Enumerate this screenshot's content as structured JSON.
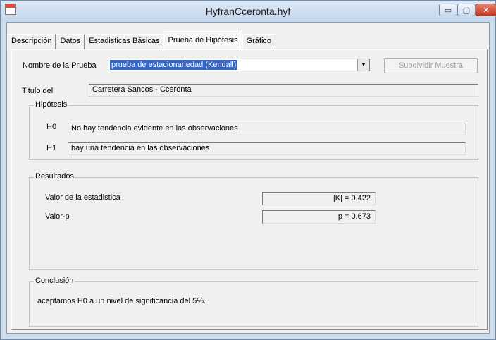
{
  "window": {
    "title": "HyfranCceronta.hyf",
    "controls": {
      "minimize": "▭",
      "maximize": "▢",
      "close": "✕"
    }
  },
  "tabs": [
    {
      "label": "Descripción"
    },
    {
      "label": "Datos"
    },
    {
      "label": "Estadisticas Básicas"
    },
    {
      "label": "Prueba de Hipótesis"
    },
    {
      "label": "Gráfico"
    }
  ],
  "active_tab": "Prueba de Hipótesis",
  "test": {
    "name_label": "Nombre de la Prueba",
    "name_value": "prueba de estacionariedad (Kendall)",
    "subdivide_button": "Subdividir Muestra",
    "title_label": "Titulo del",
    "title_value": "Carretera Sancos - Cceronta"
  },
  "hypotheses": {
    "legend": "Hipótesis",
    "h0_label": "H0",
    "h0_text": "No hay tendencia evidente en las observaciones",
    "h1_label": "H1",
    "h1_text": "hay una tendencia en las observaciones"
  },
  "results": {
    "legend": "Resultados",
    "statistic_label": "Valor de la estadistica",
    "statistic_value": "|K| =  0.422",
    "pvalue_label": "Valor-p",
    "pvalue_value": "p =  0.673"
  },
  "conclusion": {
    "legend": "Conclusión",
    "text": "aceptamos H0 a un nivel de significancia del 5%."
  },
  "colors": {
    "selection": "#3366cc",
    "titlebar": "#c4d6ec",
    "close_button": "#c1351c"
  }
}
